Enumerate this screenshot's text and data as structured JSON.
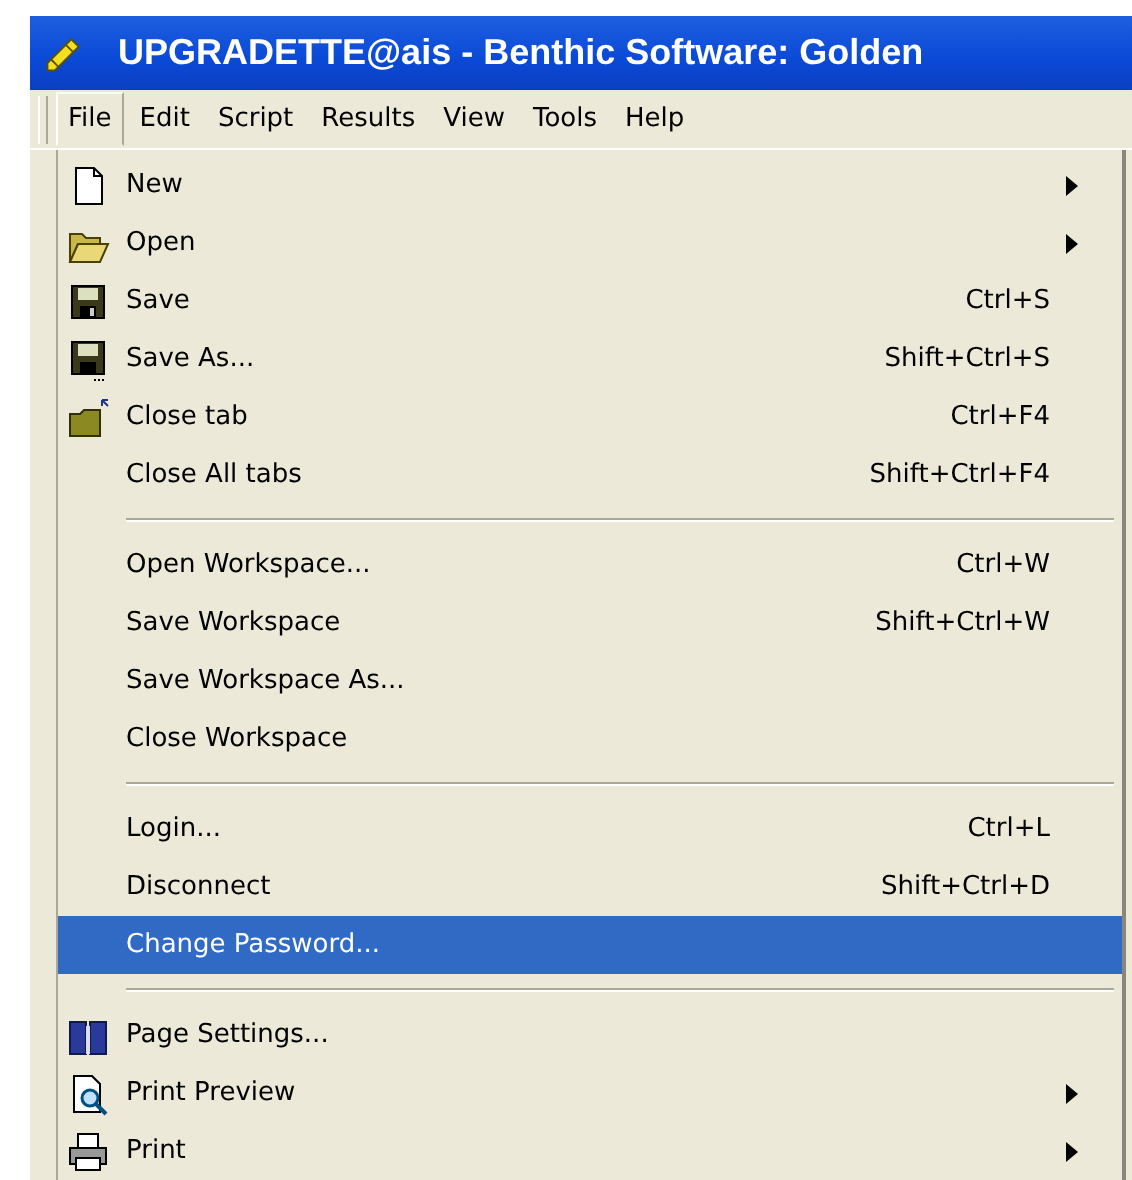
{
  "window": {
    "title": "UPGRADETTE@ais - Benthic Software: Golden"
  },
  "menubar": [
    {
      "label": "File",
      "selected": true
    },
    {
      "label": "Edit",
      "selected": false
    },
    {
      "label": "Script",
      "selected": false
    },
    {
      "label": "Results",
      "selected": false
    },
    {
      "label": "View",
      "selected": false
    },
    {
      "label": "Tools",
      "selected": false
    },
    {
      "label": "Help",
      "selected": false
    }
  ],
  "file_menu": [
    {
      "kind": "item",
      "label": "New",
      "submenu": true,
      "selected": false
    },
    {
      "kind": "item",
      "label": "Open",
      "submenu": true,
      "selected": false
    },
    {
      "kind": "item",
      "label": "Save",
      "shortcut": "Ctrl+S",
      "selected": false
    },
    {
      "kind": "item",
      "label": "Save As...",
      "shortcut": "Shift+Ctrl+S",
      "selected": false
    },
    {
      "kind": "item",
      "label": "Close tab",
      "shortcut": "Ctrl+F4",
      "selected": false
    },
    {
      "kind": "item",
      "label": "Close All tabs",
      "shortcut": "Shift+Ctrl+F4",
      "selected": false
    },
    {
      "kind": "separator"
    },
    {
      "kind": "item",
      "label": "Open Workspace...",
      "shortcut": "Ctrl+W",
      "selected": false
    },
    {
      "kind": "item",
      "label": "Save Workspace",
      "shortcut": "Shift+Ctrl+W",
      "selected": false
    },
    {
      "kind": "item",
      "label": "Save Workspace As...",
      "selected": false
    },
    {
      "kind": "item",
      "label": "Close Workspace",
      "selected": false
    },
    {
      "kind": "separator"
    },
    {
      "kind": "item",
      "label": "Login...",
      "shortcut": "Ctrl+L",
      "selected": false
    },
    {
      "kind": "item",
      "label": "Disconnect",
      "shortcut": "Shift+Ctrl+D",
      "selected": false
    },
    {
      "kind": "item",
      "label": "Change Password...",
      "selected": true
    },
    {
      "kind": "separator"
    },
    {
      "kind": "item",
      "label": "Page Settings...",
      "selected": false
    },
    {
      "kind": "item",
      "label": "Print Preview",
      "submenu": true,
      "selected": false
    },
    {
      "kind": "item",
      "label": "Print",
      "submenu": true,
      "selected": false
    }
  ]
}
